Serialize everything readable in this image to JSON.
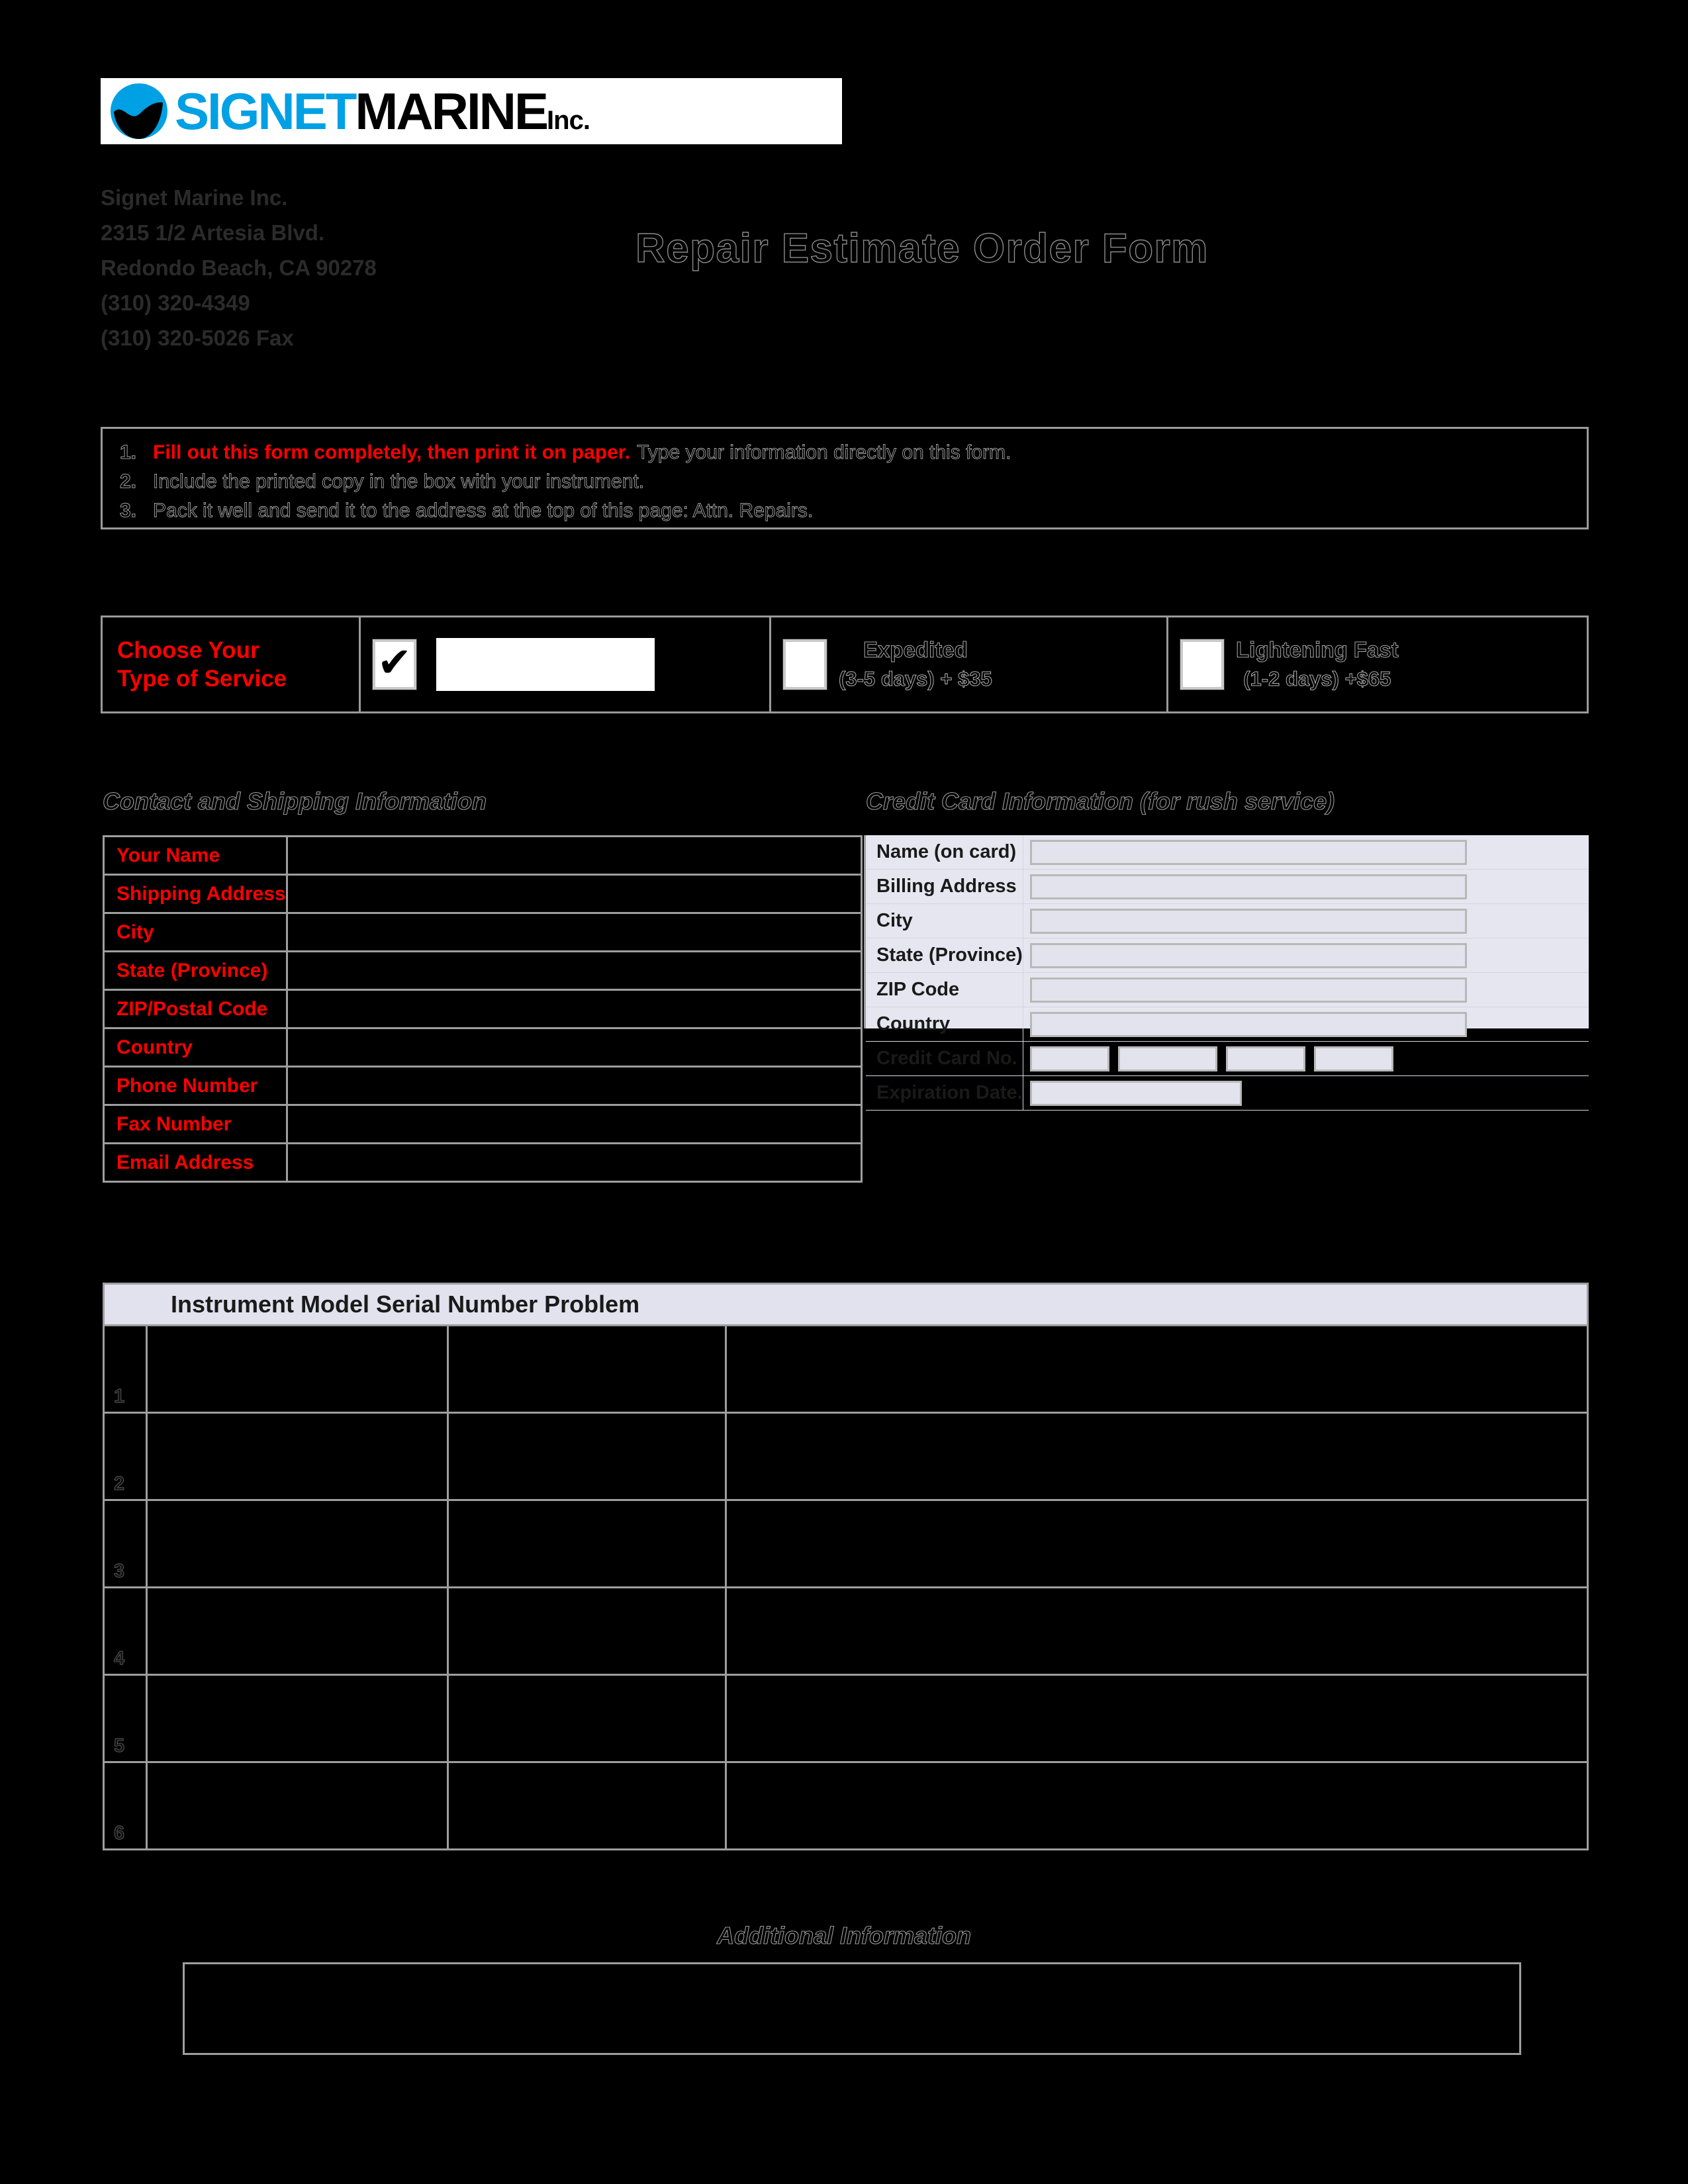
{
  "company": {
    "logo": {
      "brand_part1": "SIGNET",
      "brand_part2": "MARINE",
      "brand_suffix": "Inc.",
      "brand_color": "#00A0E4"
    },
    "address_lines": [
      "Signet Marine Inc.",
      "2315 1/2 Artesia Blvd.",
      "Redondo Beach, CA 90278",
      "(310) 320-4349",
      "(310) 320-5026 Fax"
    ]
  },
  "form_title": "Repair Estimate Order Form",
  "instructions": [
    {
      "number": "1.",
      "strong": "Fill out this form completely, then print it on paper.",
      "rest": "Type your information directly on this form."
    },
    {
      "number": "2.",
      "strong": "",
      "rest": "Include the printed copy in the box with your instrument."
    },
    {
      "number": "3.",
      "strong": "",
      "rest": "Pack it well and send it to the address at the top of this page: Attn. Repairs."
    }
  ],
  "service": {
    "label_line1": "Choose Your",
    "label_line2": "Type of Service",
    "standard": {
      "checked": true,
      "checkmark": "✔",
      "value": ""
    },
    "expedited": {
      "checked": false,
      "title": "Expedited",
      "subtitle": "(3-5 days) + $35"
    },
    "lightening_fast": {
      "checked": false,
      "title": "Lightening Fast",
      "subtitle": "(1-2 days) +$65"
    }
  },
  "contact": {
    "heading": "Contact and Shipping Information",
    "label_color": "#FF0000",
    "rows": [
      {
        "label": "Your Name",
        "value": ""
      },
      {
        "label": "Shipping Address",
        "value": ""
      },
      {
        "label": "City",
        "value": ""
      },
      {
        "label": "State (Province)",
        "value": ""
      },
      {
        "label": "ZIP/Postal Code",
        "value": ""
      },
      {
        "label": "Country",
        "value": ""
      },
      {
        "label": "Phone Number",
        "value": ""
      },
      {
        "label": "Fax Number",
        "value": ""
      },
      {
        "label": "Email Address",
        "value": ""
      }
    ]
  },
  "credit_card": {
    "heading": "Credit Card Information (for rush service)",
    "panel_color": "#e6e6f0",
    "rows": [
      {
        "label": "Name (on card)",
        "value": ""
      },
      {
        "label": "Billing Address",
        "value": ""
      },
      {
        "label": "City",
        "value": ""
      },
      {
        "label": "State (Province)",
        "value": ""
      },
      {
        "label": "ZIP Code",
        "value": ""
      },
      {
        "label": "Country",
        "value": ""
      }
    ],
    "card_number": {
      "label": "Credit Card No.",
      "groups": [
        "",
        "",
        "",
        ""
      ]
    },
    "expiration": {
      "label": "Expiration Date.",
      "value": ""
    }
  },
  "instruments": {
    "header": "Instrument Model  Serial Number  Problem",
    "columns": [
      "Instrument Model",
      "Serial Number",
      "Problem"
    ],
    "rows": [
      {
        "num": "1",
        "model": "",
        "serial": "",
        "problem": ""
      },
      {
        "num": "2",
        "model": "",
        "serial": "",
        "problem": ""
      },
      {
        "num": "3",
        "model": "",
        "serial": "",
        "problem": ""
      },
      {
        "num": "4",
        "model": "",
        "serial": "",
        "problem": ""
      },
      {
        "num": "5",
        "model": "",
        "serial": "",
        "problem": ""
      },
      {
        "num": "6",
        "model": "",
        "serial": "",
        "problem": ""
      }
    ]
  },
  "additional": {
    "heading": "Additional Information",
    "value": ""
  }
}
